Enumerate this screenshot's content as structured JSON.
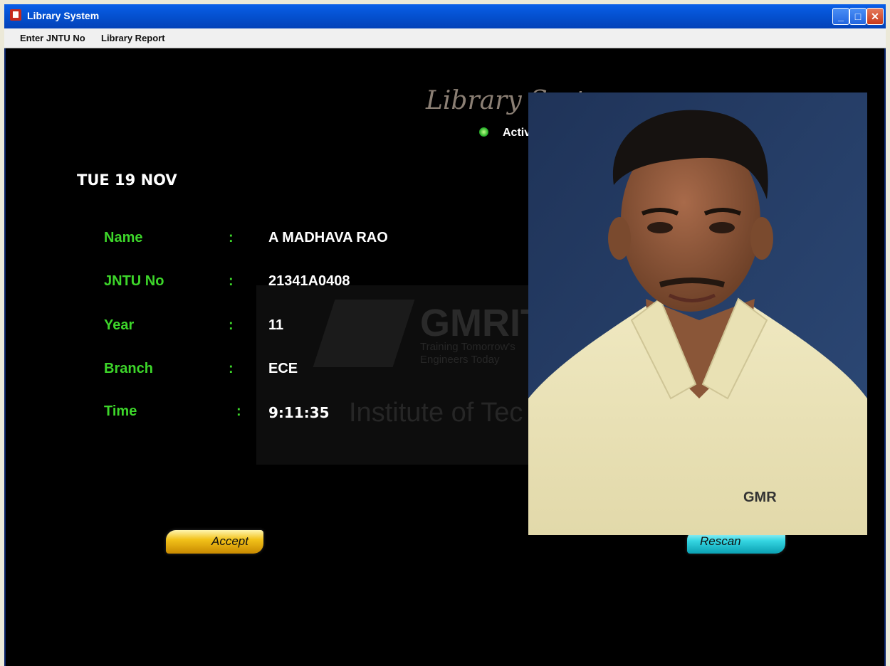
{
  "window": {
    "title": "Library System"
  },
  "menu": [
    "Enter JNTU No",
    "Library Report"
  ],
  "header": {
    "title": "Library System",
    "status": "Active"
  },
  "date": "TUE 19 NOV",
  "fields": [
    {
      "label": "Name",
      "value": "A MADHAVA RAO"
    },
    {
      "label": "JNTU No",
      "value": "21341A0408"
    },
    {
      "label": "Year",
      "value": "11"
    },
    {
      "label": "Branch",
      "value": "ECE"
    },
    {
      "label": "Time",
      "value": "9:11:35"
    }
  ],
  "watermark": {
    "brand": "GMRIT",
    "line1": "Training Tomorrow's",
    "line2": "Engineers Today",
    "institute": "Institute of Tec"
  },
  "buttons": {
    "accept": "Accept",
    "rescan": "Rescan"
  },
  "photo": {
    "shirt_logo": "GMR"
  },
  "colors": {
    "label_green": "#3dd62a",
    "accept": "#f2c21a",
    "rescan": "#35d6e2",
    "background": "#000000"
  }
}
